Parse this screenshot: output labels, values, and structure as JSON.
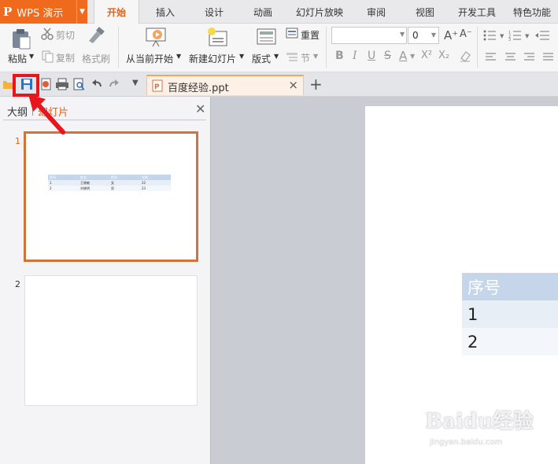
{
  "app": {
    "logo": "P",
    "name": "WPS 演示"
  },
  "menu": {
    "tabs": [
      "开始",
      "插入",
      "设计",
      "动画",
      "幻灯片放映",
      "审阅",
      "视图",
      "开发工具",
      "特色功能"
    ],
    "active": "开始"
  },
  "ribbon": {
    "paste": "粘贴",
    "cut": "剪切",
    "copy": "复制",
    "format_painter": "格式刷",
    "from_current": "从当前开始",
    "new_slide": "新建幻灯片",
    "layout": "版式",
    "reset": "重置",
    "section": "节",
    "font_size": "0",
    "format_buttons": [
      "B",
      "I",
      "U",
      "S",
      "A",
      "X²",
      "X₂"
    ]
  },
  "quick_access": {
    "document_tab": "百度经验.ppt"
  },
  "left_panel": {
    "tab_outline": "大纲",
    "tab_slides": "幻灯片",
    "slide_numbers": [
      "1",
      "2"
    ],
    "thumb_table": {
      "header": [
        "序号",
        "姓名",
        "性别",
        "年龄"
      ],
      "rows": [
        [
          "1",
          "王晓敏",
          "女",
          "22"
        ],
        [
          "2",
          "刘晓明",
          "男",
          "23"
        ]
      ]
    }
  },
  "slide": {
    "table_header": "序号",
    "rows": [
      "1",
      "2"
    ]
  },
  "watermark": {
    "brand": "Baidu经验",
    "url": "jingyan.baidu.com"
  },
  "colors": {
    "accent": "#f06a1e",
    "highlight": "#e8151c",
    "table_header": "#c5d6ea"
  }
}
